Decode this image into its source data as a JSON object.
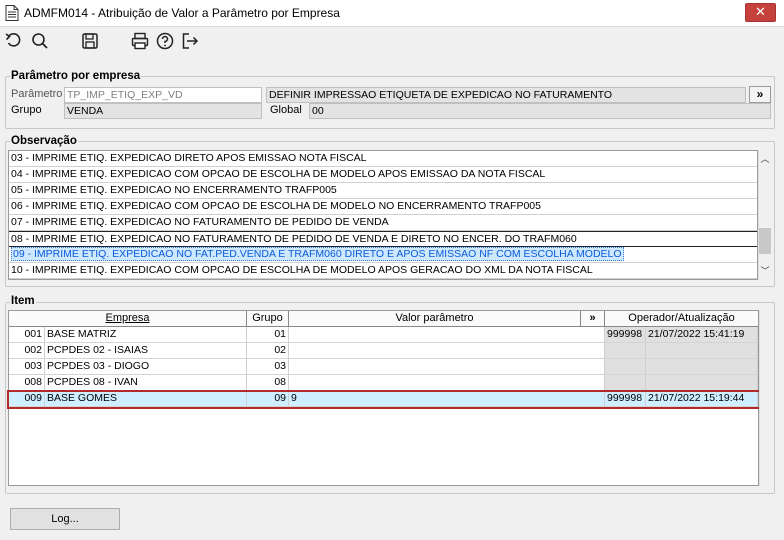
{
  "window": {
    "title": "ADMFM014 - Atribuição de Valor a Parâmetro por Empresa",
    "close_label": "✕"
  },
  "toolbar": {
    "icons": [
      "undo-icon",
      "search-icon",
      "save-icon",
      "print-icon",
      "help-icon",
      "exit-icon"
    ]
  },
  "parametro": {
    "group_title": "Parâmetro por empresa",
    "parametro_label": "Parâmetro",
    "parametro_value": "TP_IMP_ETIQ_EXP_VD",
    "descricao": "DEFINIR IMPRESSAO ETIQUETA DE EXPEDICAO NO FATURAMENTO",
    "more_label": "»",
    "grupo_label": "Grupo",
    "grupo_value": "VENDA",
    "global_label": "Global",
    "global_value": "00"
  },
  "observacao": {
    "group_title": "Observação",
    "lines": [
      "03 - IMPRIME ETIQ. EXPEDICAO DIRETO APOS EMISSAO  NOTA FISCAL",
      "04 - IMPRIME ETIQ. EXPEDICAO COM OPCAO DE ESCOLHA DE MODELO APOS EMISSAO DA NOTA FISCAL",
      "05 - IMPRIME ETIQ. EXPEDICAO NO ENCERRAMENTO TRAFP005",
      "06 - IMPRIME ETIQ. EXPEDICAO COM OPCAO DE ESCOLHA DE MODELO NO ENCERRAMENTO TRAFP005",
      "07 - IMPRIME ETIQ. EXPEDICAO NO FATURAMENTO DE PEDIDO DE VENDA",
      "08 - IMPRIME ETIQ. EXPEDICAO NO FATURAMENTO DE PEDIDO DE VENDA E DIRETO NO ENCER. DO TRAFM060",
      "09 - IMPRIME ETIQ. EXPEDICAO NO FAT.PED.VENDA E TRAFM060 DIRETO E APOS EMISSAO NF COM ESCOLHA MODELO",
      "10 - IMPRIME ETIQ. EXPEDICAO COM OPCAO DE ESCOLHA DE MODELO APOS GERACAO DO XML DA NOTA FISCAL"
    ],
    "selected_index": 6,
    "scroll_up": "︿",
    "scroll_down": "﹀"
  },
  "item": {
    "group_title": "Item",
    "headers": {
      "empresa": "Empresa",
      "grupo": "Grupo",
      "valor": "Valor parâmetro",
      "more": "»",
      "operador": "Operador/Atualização"
    },
    "rows": [
      {
        "cod": "001",
        "empresa": "BASE MATRIZ",
        "grupo": "01",
        "valor": "",
        "operador": "999998",
        "data": "21/07/2022 15:41:19"
      },
      {
        "cod": "002",
        "empresa": "PCPDES 02 - ISAIAS",
        "grupo": "02",
        "valor": "",
        "operador": "",
        "data": ""
      },
      {
        "cod": "003",
        "empresa": "PCPDES 03 - DIOGO",
        "grupo": "03",
        "valor": "",
        "operador": "",
        "data": ""
      },
      {
        "cod": "008",
        "empresa": "PCPDES 08 - IVAN",
        "grupo": "08",
        "valor": "",
        "operador": "",
        "data": ""
      },
      {
        "cod": "009",
        "empresa": "BASE GOMES",
        "grupo": "09",
        "valor": "9",
        "operador": "999998",
        "data": "21/07/2022 15:19:44"
      }
    ],
    "selected_index": 4
  },
  "buttons": {
    "log": "Log..."
  }
}
